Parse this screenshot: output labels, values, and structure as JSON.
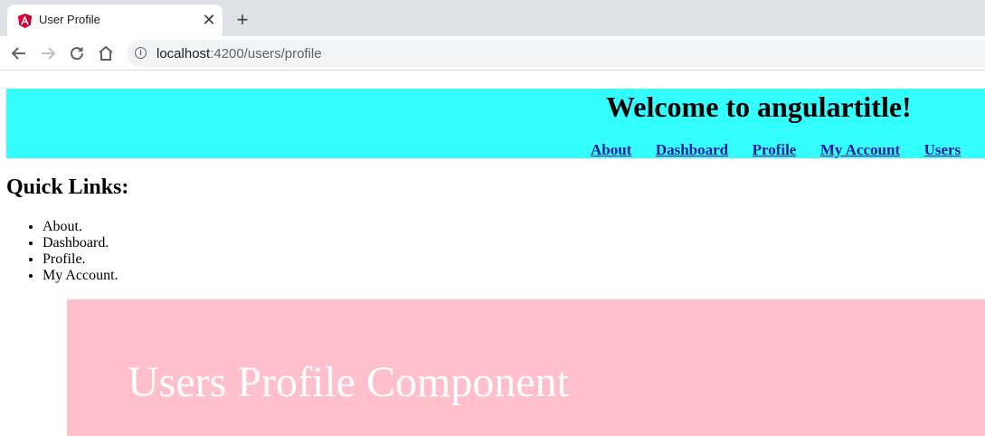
{
  "browser": {
    "tab": {
      "title": "User Profile",
      "favicon": "angular-logo-icon",
      "close_glyph": "✕"
    },
    "new_tab_glyph": "+",
    "address": {
      "host": "localhost",
      "rest": ":4200/users/profile"
    }
  },
  "app": {
    "title": "Welcome to angulartitle!",
    "nav": [
      "About",
      "Dashboard",
      "Profile",
      "My Account",
      "Users"
    ],
    "header_color": "#33ffff"
  },
  "quick_links": {
    "title": "Quick Links:",
    "items": [
      "About.",
      "Dashboard.",
      "Profile.",
      "My Account."
    ]
  },
  "profile": {
    "text": "Users Profile Component",
    "background": "#ffc0cb"
  }
}
